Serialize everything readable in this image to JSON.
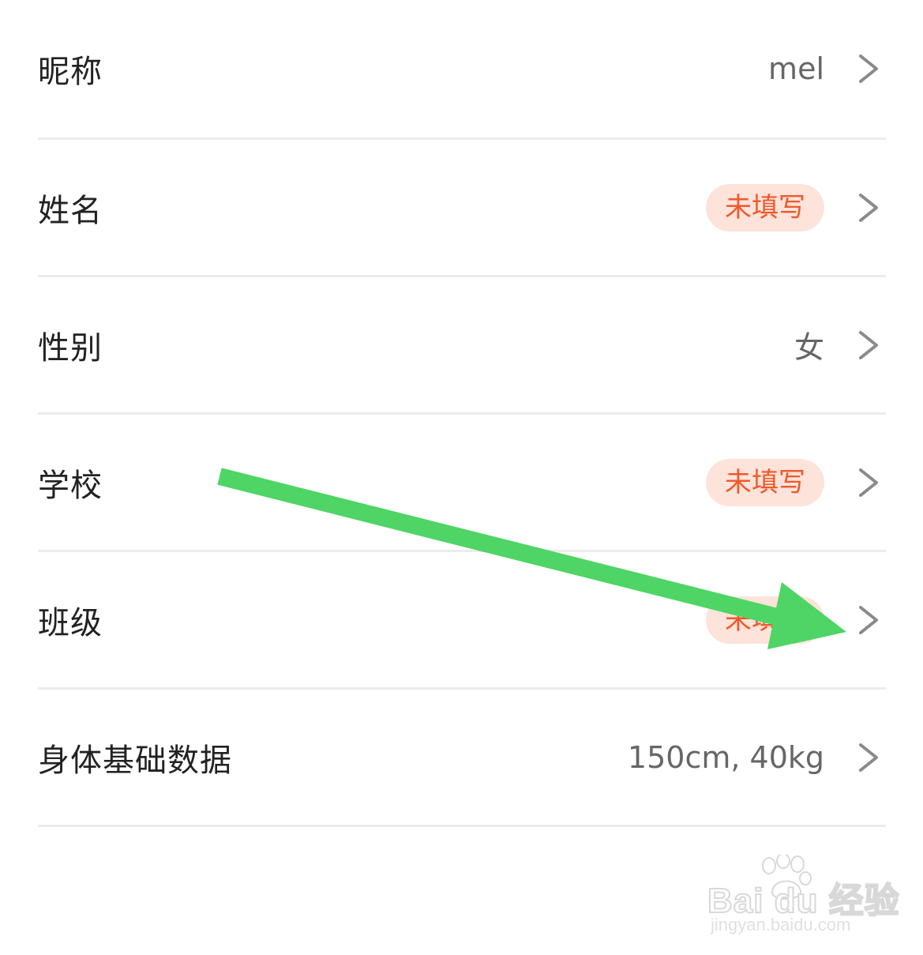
{
  "rows": [
    {
      "label": "昵称",
      "value": "mel",
      "badge": null
    },
    {
      "label": "姓名",
      "value": null,
      "badge": "未填写"
    },
    {
      "label": "性别",
      "value": "女",
      "badge": null
    },
    {
      "label": "学校",
      "value": null,
      "badge": "未填写"
    },
    {
      "label": "班级",
      "value": null,
      "badge": "未填写"
    },
    {
      "label": "身体基础数据",
      "value": "150cm, 40kg",
      "badge": null
    }
  ],
  "icons": {
    "row_chevron": "chevron-right-icon",
    "annotation": "green-arrow-icon"
  },
  "colors": {
    "badge_bg": "#fde3da",
    "badge_text": "#f0582a",
    "arrow": "#4ed565",
    "divider": "#ececec"
  },
  "watermark": {
    "brand": "Bai du 经验",
    "url": "jingyan.baidu.com"
  }
}
